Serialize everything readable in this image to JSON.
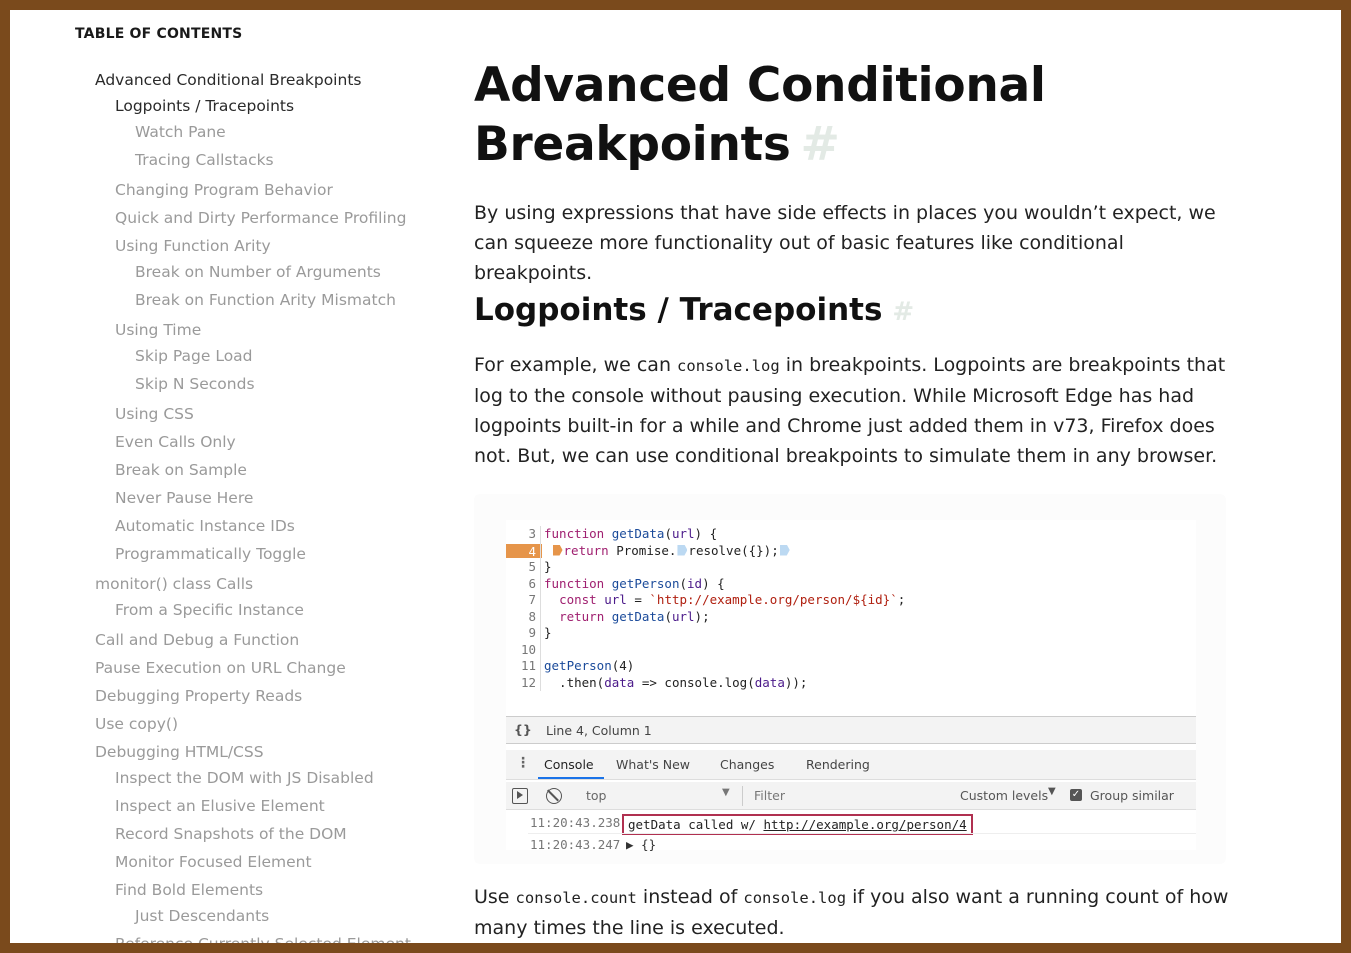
{
  "toc": {
    "title": "TABLE OF CONTENTS",
    "items": [
      {
        "label": "Advanced Conditional Breakpoints",
        "level": 1,
        "active": true
      },
      {
        "label": "Logpoints / Tracepoints",
        "level": 2,
        "active": true
      },
      {
        "label": "Watch Pane",
        "level": 3,
        "active": false
      },
      {
        "label": "Tracing Callstacks",
        "level": 3,
        "active": false
      },
      {
        "label": "Changing Program Behavior",
        "level": 2,
        "active": false
      },
      {
        "label": "Quick and Dirty Performance Profiling",
        "level": 2,
        "active": false
      },
      {
        "label": "Using Function Arity",
        "level": 2,
        "active": false
      },
      {
        "label": "Break on Number of Arguments",
        "level": 3,
        "active": false
      },
      {
        "label": "Break on Function Arity Mismatch",
        "level": 3,
        "active": false
      },
      {
        "label": "Using Time",
        "level": 2,
        "active": false
      },
      {
        "label": "Skip Page Load",
        "level": 3,
        "active": false
      },
      {
        "label": "Skip N Seconds",
        "level": 3,
        "active": false
      },
      {
        "label": "Using CSS",
        "level": 2,
        "active": false
      },
      {
        "label": "Even Calls Only",
        "level": 2,
        "active": false
      },
      {
        "label": "Break on Sample",
        "level": 2,
        "active": false
      },
      {
        "label": "Never Pause Here",
        "level": 2,
        "active": false
      },
      {
        "label": "Automatic Instance IDs",
        "level": 2,
        "active": false
      },
      {
        "label": "Programmatically Toggle",
        "level": 2,
        "active": false
      },
      {
        "label": "monitor() class Calls",
        "level": 1,
        "active": false
      },
      {
        "label": "From a Specific Instance",
        "level": 2,
        "active": false
      },
      {
        "label": "Call and Debug a Function",
        "level": 1,
        "active": false
      },
      {
        "label": "Pause Execution on URL Change",
        "level": 1,
        "active": false
      },
      {
        "label": "Debugging Property Reads",
        "level": 1,
        "active": false
      },
      {
        "label": "Use copy()",
        "level": 1,
        "active": false
      },
      {
        "label": "Debugging HTML/CSS",
        "level": 1,
        "active": false
      },
      {
        "label": "Inspect the DOM with JS Disabled",
        "level": 2,
        "active": false
      },
      {
        "label": "Inspect an Elusive Element",
        "level": 2,
        "active": false
      },
      {
        "label": "Record Snapshots of the DOM",
        "level": 2,
        "active": false
      },
      {
        "label": "Monitor Focused Element",
        "level": 2,
        "active": false
      },
      {
        "label": "Find Bold Elements",
        "level": 2,
        "active": false
      },
      {
        "label": "Just Descendants",
        "level": 3,
        "active": false
      },
      {
        "label": "Reference Currently Selected Element",
        "level": 2,
        "active": false
      }
    ]
  },
  "article": {
    "h1_line1": "Advanced Conditional",
    "h1_line2": "Breakpoints",
    "anchor": "#",
    "intro_line1": "By using expressions that have side effects in places you wouldn’t expect, we",
    "intro_line2": "can squeeze more functionality out of basic features like conditional breakpoints.",
    "h2": "Logpoints / Tracepoints",
    "p2": {
      "l1_pre": "For example, we can ",
      "l1_code": "console.log",
      "l1_post": " in breakpoints. Logpoints are breakpoints that",
      "l2": "log to the console without pausing execution. While Microsoft Edge has had",
      "l3": "logpoints built-in for a while and Chrome just added them in v73, Firefox does",
      "l4": "not. But, we can use conditional breakpoints to simulate them in any browser."
    },
    "p3": {
      "l1_pre": "Use ",
      "l1_code1": "console.count",
      "l1_mid": " instead of ",
      "l1_code2": "console.log",
      "l1_post": " if you also want a running count of how",
      "l2": "many times the line is executed."
    }
  },
  "devtools": {
    "code_lines": [
      {
        "n": "3",
        "text": "function getData(url) {"
      },
      {
        "n": "4",
        "text": "return Promise.resolve({});",
        "breakpoint": true
      },
      {
        "n": "5",
        "text": "}"
      },
      {
        "n": "6",
        "text": "function getPerson(id) {"
      },
      {
        "n": "7",
        "text": "const url = `http://example.org/person/${id}`;"
      },
      {
        "n": "8",
        "text": "return getData(url);"
      },
      {
        "n": "9",
        "text": "}"
      },
      {
        "n": "10",
        "text": ""
      },
      {
        "n": "11",
        "text": "getPerson(4)"
      },
      {
        "n": "12",
        "text": ".then(data => console.log(data));"
      }
    ],
    "status": "Line 4, Column 1",
    "braces": "{}",
    "tabs": [
      "Console",
      "What's New",
      "Changes",
      "Rendering"
    ],
    "selected_tab": "Console",
    "context": "top",
    "filter_placeholder": "Filter",
    "levels": "Custom levels",
    "group_similar": "Group similar",
    "group_similar_checked": true,
    "log": [
      {
        "time": "11:20:43.238",
        "message_pre": "getData called w/ ",
        "message_link": "http://example.org/person/4"
      },
      {
        "time": "11:20:43.247",
        "message": "▶ {}"
      }
    ]
  }
}
